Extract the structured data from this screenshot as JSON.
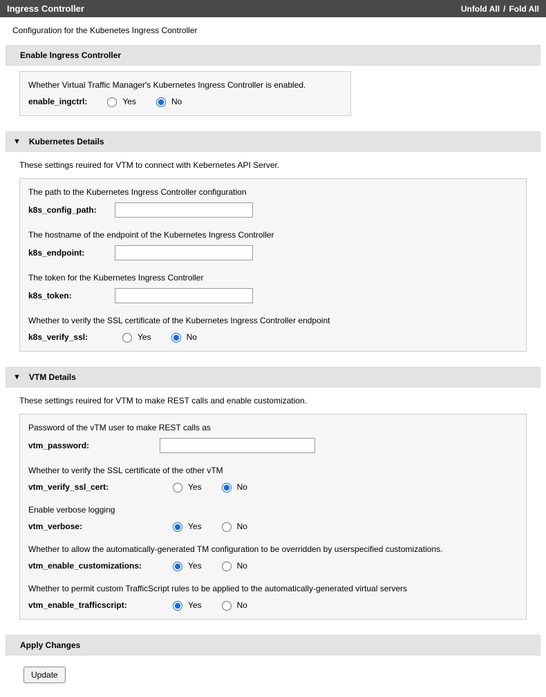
{
  "titlebar": {
    "title": "Ingress Controller",
    "unfold": "Unfold All",
    "sep": "/",
    "fold": "Fold All"
  },
  "page_desc": "Configuration for the Kubenetes Ingress Controller",
  "sections": {
    "enable": {
      "header": "Enable Ingress Controller",
      "desc": "Whether Virtual Traffic Manager's Kubernetes Ingress Controller is enabled.",
      "field_label": "enable_ingctrl:",
      "yes": "Yes",
      "no": "No",
      "selected": "No"
    },
    "k8s": {
      "header": "Kubernetes Details",
      "desc": "These settings reuired for VTM to connect with Kebernetes API Server.",
      "fields": {
        "config_path": {
          "desc": "The path to the Kubernetes Ingress Controller configuration",
          "label": "k8s_config_path:",
          "value": ""
        },
        "endpoint": {
          "desc": "The hostname of the endpoint of the Kubernetes Ingress Controller",
          "label": "k8s_endpoint:",
          "value": ""
        },
        "token": {
          "desc": "The token for the Kubernetes Ingress Controller",
          "label": "k8s_token:",
          "value": ""
        },
        "verify_ssl": {
          "desc": "Whether to verify the SSL certificate of the Kubernetes Ingress Controller endpoint",
          "label": "k8s_verify_ssl:",
          "yes": "Yes",
          "no": "No",
          "selected": "No"
        }
      }
    },
    "vtm": {
      "header": "VTM Details",
      "desc": "These settings reuired for VTM to make REST calls and enable customization.",
      "fields": {
        "password": {
          "desc": "Password of the vTM user to make REST calls as",
          "label": "vtm_password:",
          "value": ""
        },
        "verify_ssl": {
          "desc": "Whether to verify the SSL certificate of the other vTM",
          "label": "vtm_verify_ssl_cert:",
          "yes": "Yes",
          "no": "No",
          "selected": "No"
        },
        "verbose": {
          "desc": "Enable verbose logging",
          "label": "vtm_verbose:",
          "yes": "Yes",
          "no": "No",
          "selected": "Yes"
        },
        "customizations": {
          "desc": "Whether to allow the automatically-generated TM configuration to be overridden by userspecified customizations.",
          "label": "vtm_enable_customizations:",
          "yes": "Yes",
          "no": "No",
          "selected": "Yes"
        },
        "trafficscript": {
          "desc": "Whether to permit custom TrafficScript rules to be applied to the automatically-generated virtual servers",
          "label": "vtm_enable_trafficscript:",
          "yes": "Yes",
          "no": "No",
          "selected": "Yes"
        }
      }
    },
    "apply": {
      "header": "Apply Changes",
      "button": "Update"
    }
  }
}
